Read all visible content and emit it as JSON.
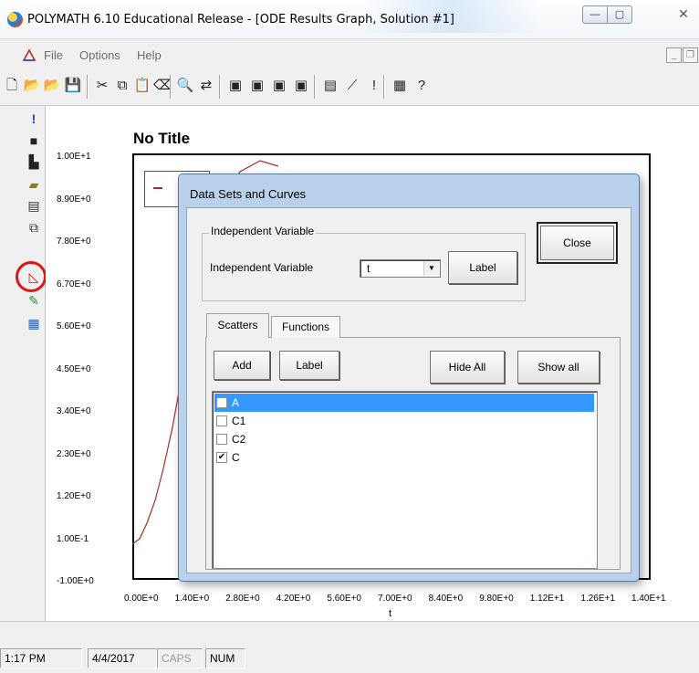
{
  "window": {
    "title": "POLYMATH 6.10 Educational Release - [ODE Results Graph, Solution #1]",
    "minimize_glyph": "—",
    "maximize_glyph": "▢",
    "close_glyph": "✕"
  },
  "menu": {
    "items": [
      "File",
      "Options",
      "Help"
    ],
    "mdi_min_glyph": "_",
    "mdi_restore_glyph": "❐"
  },
  "toolbar": {
    "icons": [
      {
        "name": "new-file-icon",
        "glyph": "🗋"
      },
      {
        "name": "open-folder-icon",
        "glyph": "📂"
      },
      {
        "name": "open-example-icon",
        "glyph": "📂"
      },
      {
        "name": "save-icon",
        "glyph": "💾"
      },
      {
        "name": "cut-icon",
        "glyph": "✂"
      },
      {
        "name": "copy-icon",
        "glyph": "⧉"
      },
      {
        "name": "paste-icon",
        "glyph": "📋"
      },
      {
        "name": "eraser-icon",
        "glyph": "⌫"
      },
      {
        "name": "find-icon",
        "glyph": "🔍"
      },
      {
        "name": "replace-icon",
        "glyph": "⇄"
      },
      {
        "name": "linear-equations-icon",
        "glyph": "▣"
      },
      {
        "name": "nonlinear-equations-icon",
        "glyph": "▣"
      },
      {
        "name": "ode-icon",
        "glyph": "▣"
      },
      {
        "name": "regression-icon",
        "glyph": "▣"
      },
      {
        "name": "calculator-icon",
        "glyph": "▤"
      },
      {
        "name": "graph-tool-icon",
        "glyph": "⟋"
      },
      {
        "name": "solve-icon",
        "glyph": "!"
      },
      {
        "name": "spreadsheet-icon",
        "glyph": "▦"
      },
      {
        "name": "help-icon",
        "glyph": "?"
      }
    ]
  },
  "sidebar": {
    "icons": [
      {
        "name": "run-icon",
        "glyph": "!",
        "color": "#1f3fcf"
      },
      {
        "name": "save-icon",
        "glyph": "■",
        "color": "#222222"
      },
      {
        "name": "save-as-icon",
        "glyph": "▙",
        "color": "#222222"
      },
      {
        "name": "open-icon",
        "glyph": "▰",
        "color": "#9a7a10"
      },
      {
        "name": "print-icon",
        "glyph": "▤",
        "color": "#333333"
      },
      {
        "name": "copy-icon",
        "glyph": "⧉",
        "color": "#333333"
      },
      {
        "name": "graph-settings-icon",
        "glyph": "◺",
        "color": "#c02020"
      },
      {
        "name": "brush-icon",
        "glyph": "✎",
        "color": "#2a8a2a"
      },
      {
        "name": "table-icon",
        "glyph": "▦",
        "color": "#2a5ca8"
      }
    ]
  },
  "graph": {
    "title": "No Title",
    "x_label": "t",
    "y_ticks": [
      "1.00E+1",
      "8.90E+0",
      "7.80E+0",
      "6.70E+0",
      "5.60E+0",
      "4.50E+0",
      "3.40E+0",
      "2.30E+0",
      "1.20E+0",
      "1.00E-1",
      "-1.00E+0"
    ],
    "x_ticks": [
      "0.00E+0",
      "1.40E+0",
      "2.80E+0",
      "4.20E+0",
      "5.60E+0",
      "7.00E+0",
      "8.40E+0",
      "9.80E+0",
      "1.12E+1",
      "1.26E+1",
      "1.40E+1"
    ],
    "curve_color": "#a0302a"
  },
  "dialog": {
    "title": "Data Sets and Curves",
    "close_label": "Close",
    "independent_group_label": "Independent Variable",
    "independent_field_label": "Independent Variable",
    "independent_value": "t",
    "dropdown_glyph": "▼",
    "label_button": "Label",
    "tabs": [
      "Scatters",
      "Functions"
    ],
    "add_label": "Add",
    "scatter_label_button": "Label",
    "hide_all_label": "Hide All",
    "show_all_label": "Show all",
    "check_glyph": "✔",
    "items": [
      {
        "label": "A",
        "checked": false,
        "selected": true
      },
      {
        "label": "C1",
        "checked": false,
        "selected": false
      },
      {
        "label": "C2",
        "checked": false,
        "selected": false
      },
      {
        "label": "C",
        "checked": true,
        "selected": false
      }
    ]
  },
  "status": {
    "time": "1:17 PM",
    "date": "4/4/2017",
    "caps": "CAPS",
    "num": "NUM"
  }
}
